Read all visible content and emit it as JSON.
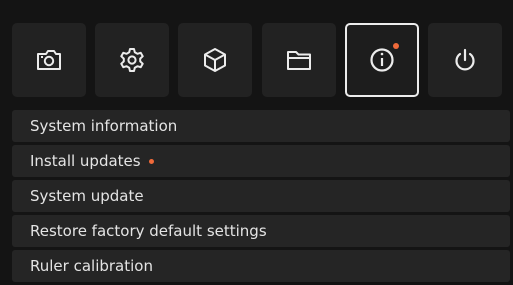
{
  "toolbar": {
    "tabs": [
      {
        "icon": "camera-icon",
        "active": false
      },
      {
        "icon": "gear-icon",
        "active": false
      },
      {
        "icon": "cube-icon",
        "active": false
      },
      {
        "icon": "folder-icon",
        "active": false
      },
      {
        "icon": "info-icon",
        "active": true,
        "notification": true
      },
      {
        "icon": "power-icon",
        "active": false
      }
    ]
  },
  "menu": {
    "items": [
      {
        "label": "System information"
      },
      {
        "label": "Install updates",
        "notification": true
      },
      {
        "label": "System update"
      },
      {
        "label": "Restore factory default settings"
      },
      {
        "label": "Ruler calibration"
      }
    ]
  },
  "colors": {
    "background": "#141414",
    "tile": "#222222",
    "active_border": "#ececec",
    "text": "#e4e4e4",
    "notification": "#f06a3a"
  }
}
